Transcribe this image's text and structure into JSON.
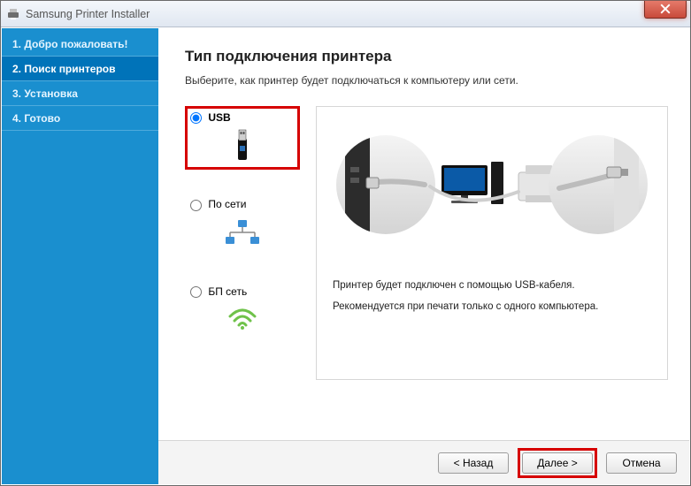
{
  "window": {
    "title": "Samsung Printer Installer"
  },
  "sidebar": {
    "steps": [
      {
        "label": "1. Добро пожаловать!"
      },
      {
        "label": "2. Поиск принтеров"
      },
      {
        "label": "3. Установка"
      },
      {
        "label": "4. Готово"
      }
    ],
    "activeIndex": 1
  },
  "main": {
    "heading": "Тип подключения принтера",
    "subtitle": "Выберите, как принтер будет подключаться к компьютеру или сети."
  },
  "options": {
    "usb": "USB",
    "network": "По сети",
    "wireless": "БП сеть"
  },
  "preview": {
    "line1": "Принтер будет подключен с помощью USB-кабеля.",
    "line2": "Рекомендуется при печати только с одного компьютера."
  },
  "buttons": {
    "back": "< Назад",
    "next": "Далее >",
    "cancel": "Отмена"
  }
}
